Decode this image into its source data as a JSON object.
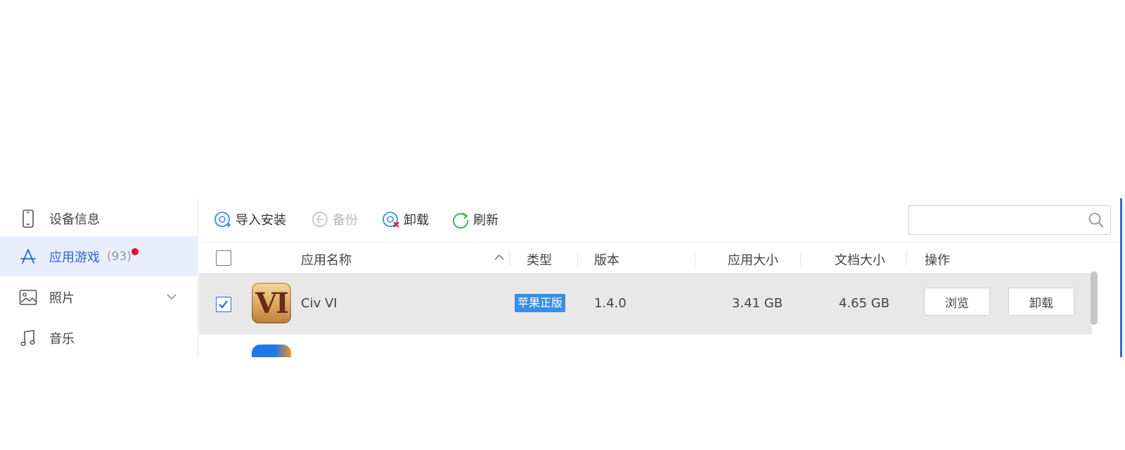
{
  "sidebar": {
    "items": [
      {
        "label": "设备信息",
        "icon": "phone-icon"
      },
      {
        "label": "应用游戏",
        "icon": "app-store-icon",
        "count": "(93)",
        "active": true
      },
      {
        "label": "照片",
        "icon": "photo-icon"
      },
      {
        "label": "音乐",
        "icon": "music-note-icon"
      }
    ]
  },
  "toolbar": {
    "import_label": "导入安装",
    "backup_label": "备份",
    "uninstall_label": "卸载",
    "refresh_label": "刷新"
  },
  "search": {
    "value": "",
    "placeholder": ""
  },
  "table": {
    "columns": {
      "name": "应用名称",
      "type": "类型",
      "version": "版本",
      "app_size": "应用大小",
      "doc_size": "文档大小",
      "ops": "操作"
    },
    "rows": [
      {
        "checked": true,
        "icon_text": "VI",
        "name": "Civ VI",
        "type": "苹果正版",
        "version": "1.4.0",
        "app_size": "3.41 GB",
        "doc_size": "4.65 GB",
        "browse_label": "浏览",
        "uninstall_label": "卸载"
      }
    ]
  },
  "colors": {
    "accent": "#2d63db",
    "active_bg": "#e9eefd",
    "badge_bg": "#3a8ee6",
    "notify_dot": "#e8102a",
    "selected_row_bg": "#e8e8e8"
  }
}
